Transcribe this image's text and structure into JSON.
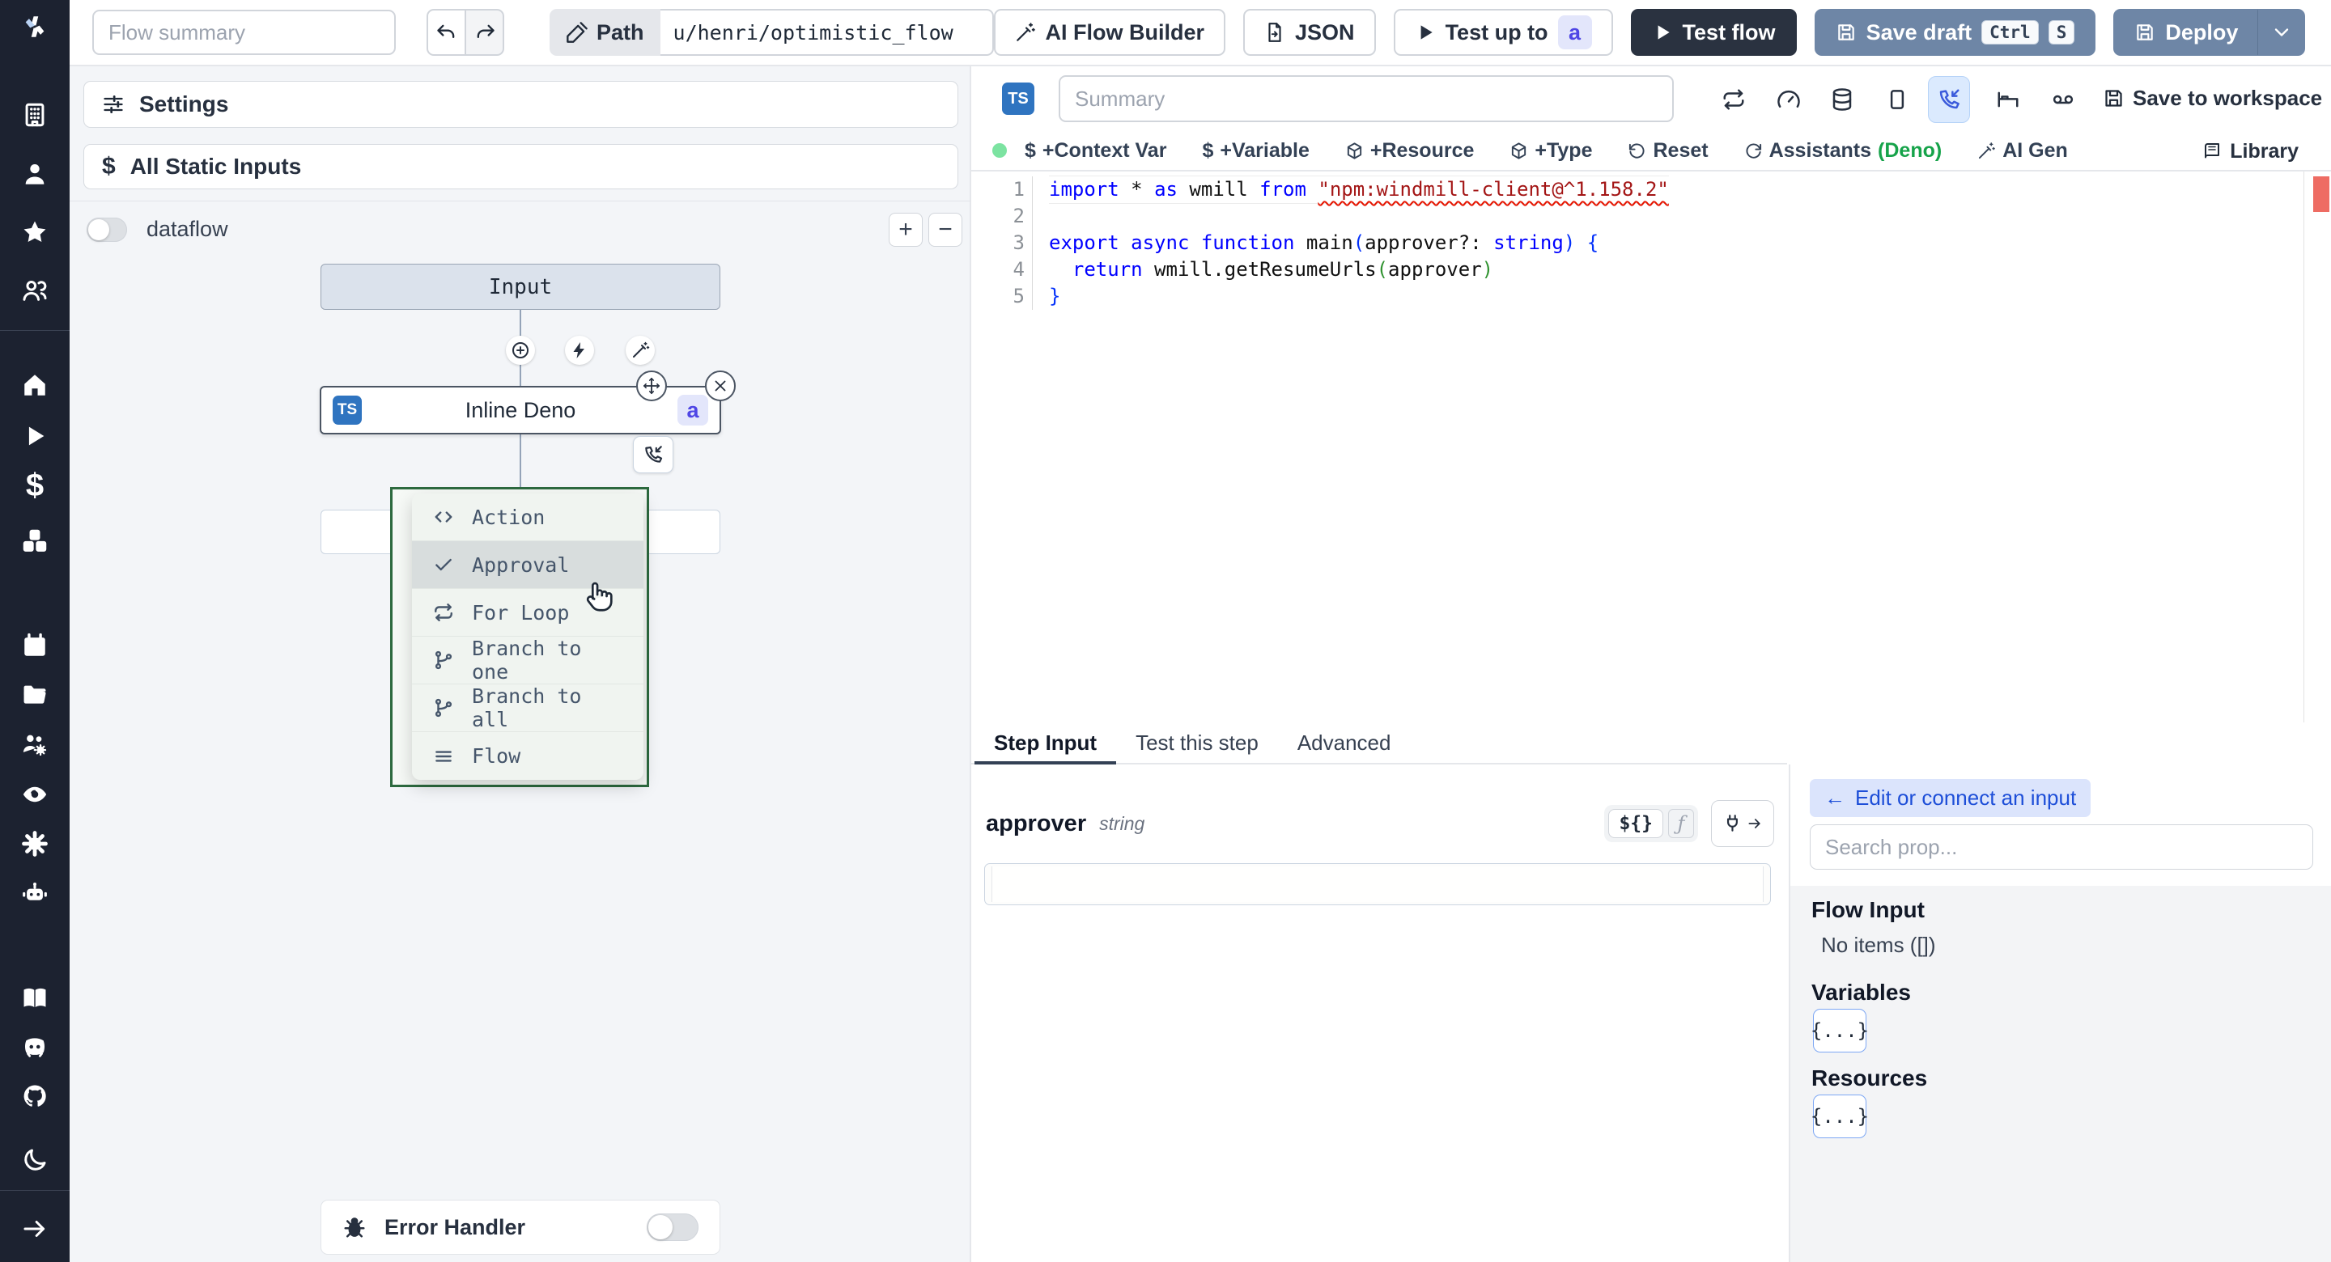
{
  "top_bar": {
    "flow_summary_placeholder": "Flow summary",
    "path_label": "Path",
    "path_value": "u/henri/optimistic_flow",
    "ai_flow_builder_label": "AI Flow Builder",
    "json_label": "JSON",
    "test_up_to_label": "Test up to",
    "test_up_to_badge": "a",
    "test_flow_label": "Test flow",
    "save_draft_label": "Save draft",
    "kbd_ctrl": "Ctrl",
    "kbd_s": "S",
    "deploy_label": "Deploy"
  },
  "sidebar": {
    "icons": [
      "windmill-logo",
      "building",
      "user",
      "star",
      "users",
      "home",
      "play",
      "dollar",
      "boxes",
      "calendar",
      "folder",
      "users-settings",
      "eye",
      "gear",
      "bot",
      "book",
      "discord",
      "github",
      "moon",
      "expand-arrow"
    ],
    "dollar_glyph": "$"
  },
  "flow_panel": {
    "settings_label": "Settings",
    "static_inputs_label": "All Static Inputs",
    "static_inputs_dollar": "$",
    "dataflow_label": "dataflow",
    "zoom_in": "+",
    "zoom_out": "−",
    "input_node_label": "Input",
    "step_node": {
      "lang_badge": "TS",
      "label": "Inline Deno",
      "suffix_badge": "a"
    },
    "insert_menu": {
      "items": [
        {
          "icon": "code-icon",
          "label": "Action"
        },
        {
          "icon": "check-icon",
          "label": "Approval",
          "highlighted": true
        },
        {
          "icon": "repeat-icon",
          "label": "For Loop"
        },
        {
          "icon": "git-branch-icon",
          "label": "Branch to one"
        },
        {
          "icon": "git-branch-icon",
          "label": "Branch to all"
        },
        {
          "icon": "list-icon",
          "label": "Flow"
        }
      ]
    },
    "error_handler_label": "Error Handler"
  },
  "editor": {
    "lang_badge": "TS",
    "summary_placeholder": "Summary",
    "icon_buttons": [
      "repeat",
      "gauge",
      "database",
      "square",
      "phone-incoming",
      "bed",
      "voicemail"
    ],
    "save_to_workspace_label": "Save to workspace",
    "actions": [
      {
        "label": "+Context Var",
        "icon": "dollar"
      },
      {
        "label": "+Variable",
        "icon": "dollar"
      },
      {
        "label": "+Resource",
        "icon": "package"
      },
      {
        "label": "+Type",
        "icon": "package"
      },
      {
        "label": "Reset",
        "icon": "rotate-ccw"
      },
      {
        "label": "Assistants",
        "suffix": "(Deno)",
        "icon": "refresh"
      },
      {
        "label": "AI Gen",
        "icon": "wand"
      }
    ],
    "library_label": "Library",
    "code": {
      "active_line": 1,
      "lines": [
        [
          {
            "c": "kw",
            "t": "import"
          },
          {
            "c": "d",
            "t": " * "
          },
          {
            "c": "kw",
            "t": "as"
          },
          {
            "c": "d",
            "t": " wmill "
          },
          {
            "c": "kw",
            "t": "from"
          },
          {
            "c": "d",
            "t": " "
          },
          {
            "c": "sq",
            "t": "\"npm:windmill-client@^1.158.2\""
          }
        ],
        [],
        [
          {
            "c": "kw",
            "t": "export"
          },
          {
            "c": "d",
            "t": " "
          },
          {
            "c": "kw",
            "t": "async"
          },
          {
            "c": "d",
            "t": " "
          },
          {
            "c": "kw",
            "t": "function"
          },
          {
            "c": "d",
            "t": " main"
          },
          {
            "c": "b1",
            "t": "("
          },
          {
            "c": "d",
            "t": "approver?: "
          },
          {
            "c": "kw",
            "t": "string"
          },
          {
            "c": "b1",
            "t": ")"
          },
          {
            "c": "d",
            "t": " "
          },
          {
            "c": "b1",
            "t": "{"
          }
        ],
        [
          {
            "c": "d",
            "t": "  "
          },
          {
            "c": "kw",
            "t": "return"
          },
          {
            "c": "d",
            "t": " wmill.getResumeUrls"
          },
          {
            "c": "b2",
            "t": "("
          },
          {
            "c": "d",
            "t": "approver"
          },
          {
            "c": "b2",
            "t": ")"
          }
        ],
        [
          {
            "c": "b1",
            "t": "}"
          }
        ]
      ]
    }
  },
  "tabs": [
    {
      "label": "Step Input",
      "active": true
    },
    {
      "label": "Test this step",
      "active": false
    },
    {
      "label": "Advanced",
      "active": false
    }
  ],
  "step_input": {
    "arg_name": "approver",
    "arg_type": "string",
    "template_toggle": "${}",
    "fx_toggle": "ƒ",
    "input_value": ""
  },
  "connect_panel": {
    "edit_pill_arrow": "←",
    "edit_pill_label": "Edit or connect an input",
    "search_placeholder": "Search prop...",
    "flow_input_title": "Flow Input",
    "flow_input_empty": "No items ([])",
    "variables_title": "Variables",
    "variables_chip": "{...}",
    "resources_title": "Resources",
    "resources_chip": "{...}"
  },
  "colors": {
    "sidebar_bg": "#1c2230",
    "accent_ts_blue": "#2f74c0",
    "action_slate_blue": "#6e86a6",
    "dark_navy": "#2a3240",
    "badge_indigo_bg": "#e3e6fb",
    "badge_indigo_text": "#4f46e5",
    "menu_green_border": "#2d6a3f",
    "deno_green": "#16a34a",
    "error_marker_red": "#ee6c63",
    "highlight_blue_bg": "#dbeafe"
  }
}
